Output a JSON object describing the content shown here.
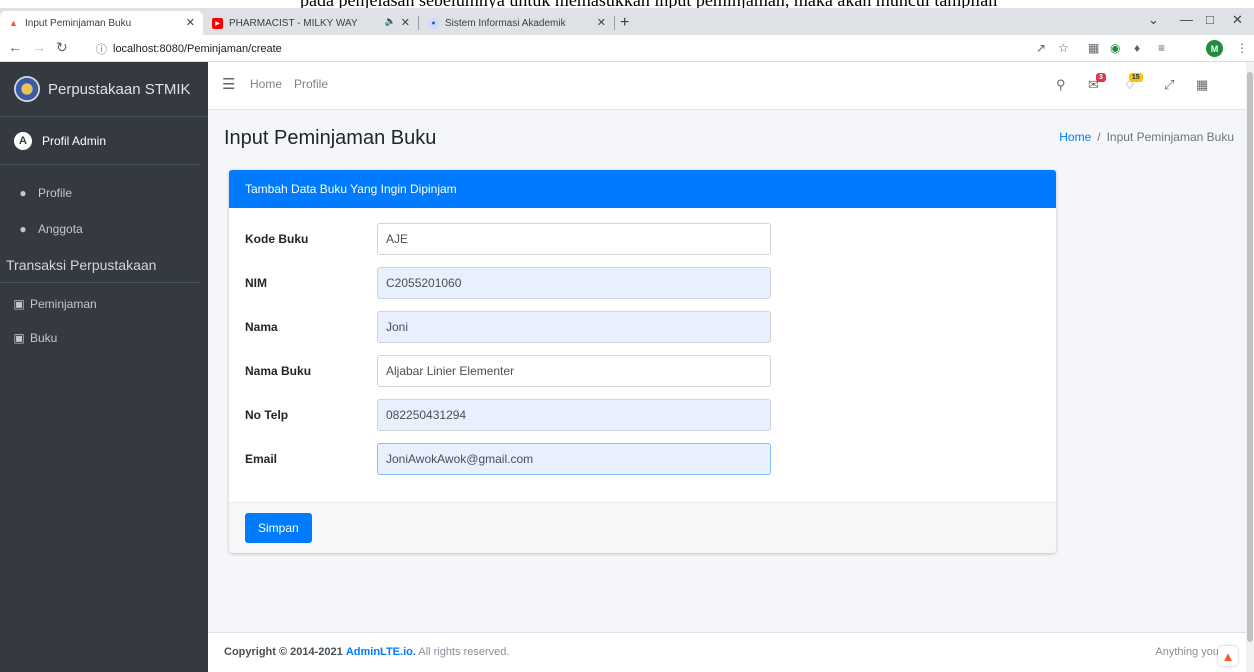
{
  "doc_overlap_text": "pada penjelasan sebelumnya untuk memasukkan input peminjaman, maka akan muncul tampilan",
  "browser": {
    "tabs": [
      {
        "title": "Input Peminjaman Buku",
        "icon": "flame-icon",
        "active": true
      },
      {
        "title": "PHARMACIST - MILKY WAY",
        "icon": "youtube-icon",
        "active": false
      },
      {
        "title": "Sistem Informasi Akademik",
        "icon": "site-icon",
        "active": false
      }
    ],
    "url": "localhost:8080/Peminjaman/create",
    "profile_initial": "M"
  },
  "sidebar": {
    "brand": "Perpustakaan STMIK",
    "user": "Profil Admin",
    "items": [
      {
        "label": "Profile",
        "icon": "user-icon"
      },
      {
        "label": "Anggota",
        "icon": "user-icon"
      }
    ],
    "section_header": "Transaksi Perpustakaan",
    "section_items": [
      {
        "label": "Peminjaman",
        "icon": "book-icon"
      },
      {
        "label": "Buku",
        "icon": "book-icon"
      }
    ]
  },
  "navbar": {
    "links": [
      "Home",
      "Profile"
    ],
    "messages_badge": "3",
    "notifications_badge": "15"
  },
  "page": {
    "title": "Input Peminjaman Buku",
    "breadcrumb": {
      "home": "Home",
      "current": "Input Peminjaman Buku"
    }
  },
  "form": {
    "header": "Tambah Data Buku Yang Ingin Dipinjam",
    "fields": [
      {
        "label": "Kode Buku",
        "value": "AJE"
      },
      {
        "label": "NIM",
        "value": "C2055201060"
      },
      {
        "label": "Nama",
        "value": "Joni"
      },
      {
        "label": "Nama Buku",
        "value": "Aljabar Linier Elementer"
      },
      {
        "label": "No Telp",
        "value": "082250431294"
      },
      {
        "label": "Email",
        "value": "JoniAwokAwok@gmail.com"
      }
    ],
    "submit_label": "Simpan"
  },
  "footer": {
    "copyright_prefix": "Copyright © 2014-2021",
    "brand": "AdminLTE.io.",
    "suffix": "All rights reserved.",
    "right_text": "Anything you w"
  },
  "colors": {
    "primary": "#007bff",
    "sidebar": "#343a40"
  }
}
